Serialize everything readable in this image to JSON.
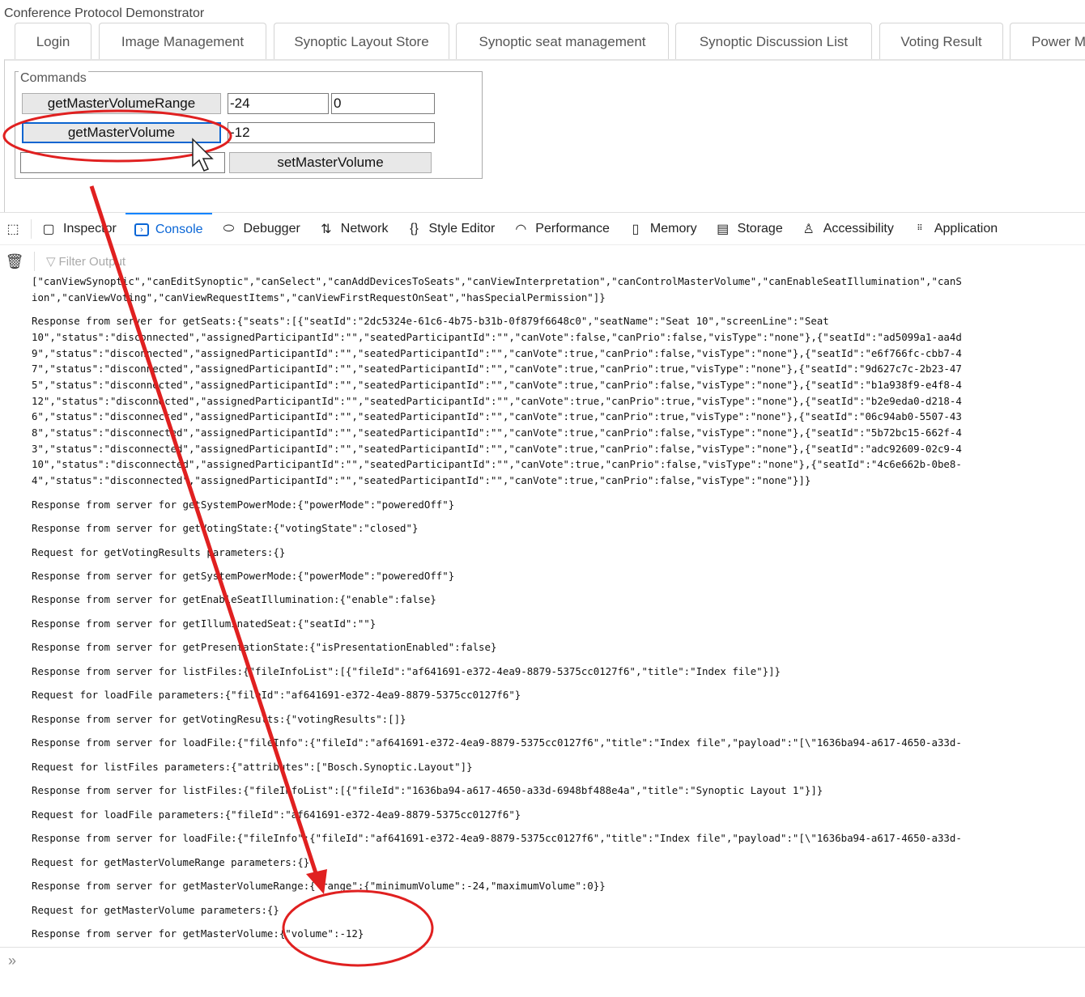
{
  "app": {
    "title": "Conference Protocol Demonstrator"
  },
  "tabs": [
    "Login",
    "Image Management",
    "Synoptic Layout Store",
    "Synoptic seat management",
    "Synoptic Discussion List",
    "Voting Result",
    "Power M"
  ],
  "commands": {
    "legend": "Commands",
    "get_range_label": "getMasterVolumeRange",
    "range_min": "-24",
    "range_max": "0",
    "get_volume_label": "getMasterVolume",
    "volume_value": "-12",
    "set_volume_input": "",
    "set_volume_label": "setMasterVolume"
  },
  "devtools": {
    "tabs": [
      "Inspector",
      "Console",
      "Debugger",
      "Network",
      "Style Editor",
      "Performance",
      "Memory",
      "Storage",
      "Accessibility",
      "Application"
    ],
    "active_tab": "Console",
    "filter_placeholder": "Filter Output",
    "prompt": "»"
  },
  "console": [
    [
      "[\"canViewSynoptic\",\"canEditSynoptic\",\"canSelect\",\"canAddDevicesToSeats\",\"canViewInterpretation\",\"canControlMasterVolume\",\"canEnableSeatIllumination\",\"canS",
      "ion\",\"canViewVoting\",\"canViewRequestItems\",\"canViewFirstRequestOnSeat\",\"hasSpecialPermission\"]}"
    ],
    [
      "Response from server for getSeats:{\"seats\":[{\"seatId\":\"2dc5324e-61c6-4b75-b31b-0f879f6648c0\",\"seatName\":\"Seat 10\",\"screenLine\":\"Seat",
      "10\",\"status\":\"disconnected\",\"assignedParticipantId\":\"\",\"seatedParticipantId\":\"\",\"canVote\":false,\"canPrio\":false,\"visType\":\"none\"},{\"seatId\":\"ad5099a1-aa4d",
      "9\",\"status\":\"disconnected\",\"assignedParticipantId\":\"\",\"seatedParticipantId\":\"\",\"canVote\":true,\"canPrio\":false,\"visType\":\"none\"},{\"seatId\":\"e6f766fc-cbb7-4",
      "7\",\"status\":\"disconnected\",\"assignedParticipantId\":\"\",\"seatedParticipantId\":\"\",\"canVote\":true,\"canPrio\":true,\"visType\":\"none\"},{\"seatId\":\"9d627c7c-2b23-47",
      "5\",\"status\":\"disconnected\",\"assignedParticipantId\":\"\",\"seatedParticipantId\":\"\",\"canVote\":true,\"canPrio\":false,\"visType\":\"none\"},{\"seatId\":\"b1a938f9-e4f8-4",
      "12\",\"status\":\"disconnected\",\"assignedParticipantId\":\"\",\"seatedParticipantId\":\"\",\"canVote\":true,\"canPrio\":true,\"visType\":\"none\"},{\"seatId\":\"b2e9eda0-d218-4",
      "6\",\"status\":\"disconnected\",\"assignedParticipantId\":\"\",\"seatedParticipantId\":\"\",\"canVote\":true,\"canPrio\":true,\"visType\":\"none\"},{\"seatId\":\"06c94ab0-5507-43",
      "8\",\"status\":\"disconnected\",\"assignedParticipantId\":\"\",\"seatedParticipantId\":\"\",\"canVote\":true,\"canPrio\":false,\"visType\":\"none\"},{\"seatId\":\"5b72bc15-662f-4",
      "3\",\"status\":\"disconnected\",\"assignedParticipantId\":\"\",\"seatedParticipantId\":\"\",\"canVote\":true,\"canPrio\":false,\"visType\":\"none\"},{\"seatId\":\"adc92609-02c9-4",
      "10\",\"status\":\"disconnected\",\"assignedParticipantId\":\"\",\"seatedParticipantId\":\"\",\"canVote\":true,\"canPrio\":false,\"visType\":\"none\"},{\"seatId\":\"4c6e662b-0be8-",
      "4\",\"status\":\"disconnected\",\"assignedParticipantId\":\"\",\"seatedParticipantId\":\"\",\"canVote\":true,\"canPrio\":false,\"visType\":\"none\"}]}"
    ],
    [
      "Response from server for getSystemPowerMode:{\"powerMode\":\"poweredOff\"}"
    ],
    [
      "Response from server for getVotingState:{\"votingState\":\"closed\"}"
    ],
    [
      "Request for getVotingResults parameters:{}"
    ],
    [
      "Response from server for getSystemPowerMode:{\"powerMode\":\"poweredOff\"}"
    ],
    [
      "Response from server for getEnableSeatIllumination:{\"enable\":false}"
    ],
    [
      "Response from server for getIlluminatedSeat:{\"seatId\":\"\"}"
    ],
    [
      "Response from server for getPresentationState:{\"isPresentationEnabled\":false}"
    ],
    [
      "Response from server for listFiles:{\"fileInfoList\":[{\"fileId\":\"af641691-e372-4ea9-8879-5375cc0127f6\",\"title\":\"Index file\"}]}"
    ],
    [
      "Request for loadFile parameters:{\"fileId\":\"af641691-e372-4ea9-8879-5375cc0127f6\"}"
    ],
    [
      "Response from server for getVotingResults:{\"votingResults\":[]}"
    ],
    [
      "Response from server for loadFile:{\"fileInfo\":{\"fileId\":\"af641691-e372-4ea9-8879-5375cc0127f6\",\"title\":\"Index file\",\"payload\":\"[\\\"1636ba94-a617-4650-a33d-"
    ],
    [
      "Request for listFiles parameters:{\"attributes\":[\"Bosch.Synoptic.Layout\"]}"
    ],
    [
      "Response from server for listFiles:{\"fileInfoList\":[{\"fileId\":\"1636ba94-a617-4650-a33d-6948bf488e4a\",\"title\":\"Synoptic Layout 1\"}]}"
    ],
    [
      "Request for loadFile parameters:{\"fileId\":\"af641691-e372-4ea9-8879-5375cc0127f6\"}"
    ],
    [
      "Response from server for loadFile:{\"fileInfo\":{\"fileId\":\"af641691-e372-4ea9-8879-5375cc0127f6\",\"title\":\"Index file\",\"payload\":\"[\\\"1636ba94-a617-4650-a33d-"
    ],
    [
      "Request for getMasterVolumeRange parameters:{}"
    ],
    [
      "Response from server for getMasterVolumeRange:{\"range\":{\"minimumVolume\":-24,\"maximumVolume\":0}}"
    ],
    [
      "Request for getMasterVolume parameters:{}"
    ],
    [
      "Response from server for getMasterVolume:{\"volume\":-12}"
    ]
  ],
  "colors": {
    "accent": "#0a84ff",
    "annotation": "#e02020"
  }
}
